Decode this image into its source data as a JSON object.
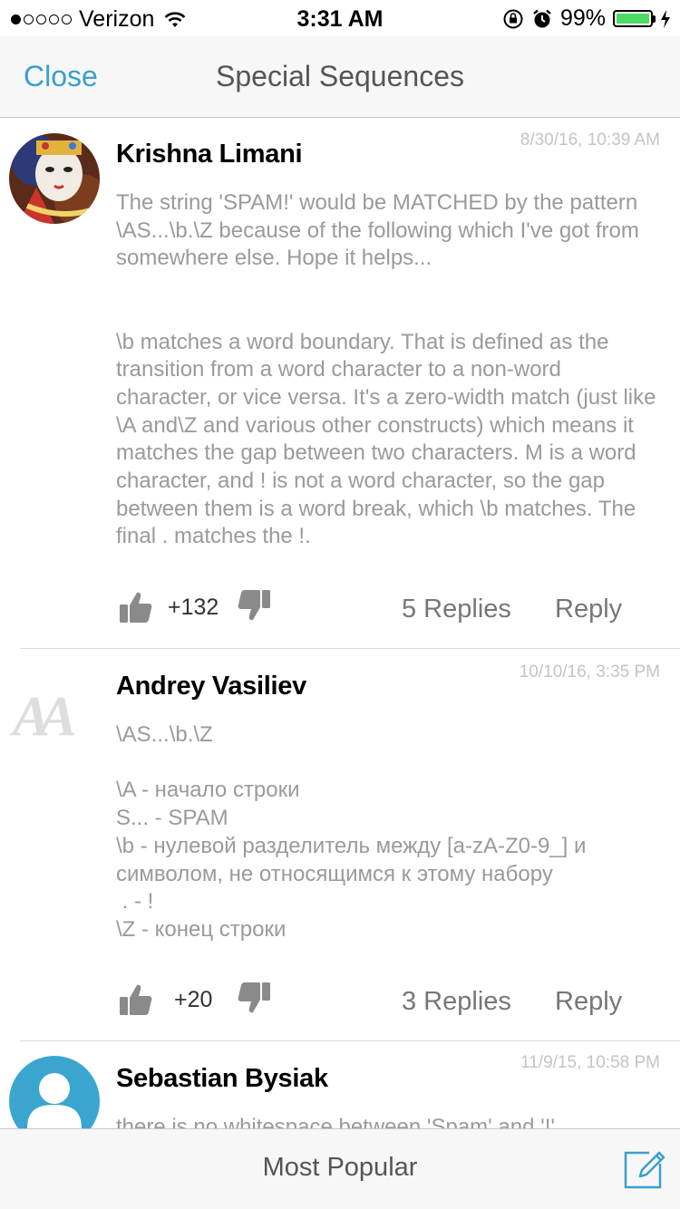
{
  "status_bar": {
    "carrier": "Verizon",
    "time": "3:31 AM",
    "battery": "99%",
    "battery_level": 0.99,
    "signal_bars_filled": 1,
    "signal_bars_total": 5
  },
  "nav": {
    "close_label": "Close",
    "title": "Special Sequences"
  },
  "comments": [
    {
      "author": "Krishna Limani",
      "date": "8/30/16, 10:39 AM",
      "body": "The string 'SPAM!' would be MATCHED by the pattern \\AS...\\b.\\Z because of the following which I've got from somewhere else. Hope it helps...\n\n\n\\b matches a word boundary. That is defined as the transition from a word character to a non-word character, or vice versa. It's a zero-width match (just like \\A and\\Z and various other constructs) which means it matches the gap between two characters. M is a word character, and ! is not a word character, so the gap between them is a word break, which \\b matches. The final . matches the !.",
      "votes": "+132",
      "replies": "5 Replies",
      "reply_label": "Reply"
    },
    {
      "author": "Andrey Vasiliev",
      "date": "10/10/16, 3:35 PM",
      "avatar_text": "AA",
      "body": "\\AS...\\b.\\Z\n\n\\A - начало строки\nS... - SPAM\n\\b - нулевой разделитель между [a-zA-Z0-9_] и символом, не относящимся к этому набору\n . - !\n\\Z - конец строки",
      "votes": "+20",
      "replies": "3 Replies",
      "reply_label": "Reply"
    },
    {
      "author": "Sebastian Bysiak",
      "date": "11/9/15, 10:58 PM",
      "body": "there is no whitespace between 'Spam' and '!'"
    }
  ],
  "tab_bar": {
    "label": "Most Popular"
  },
  "colors": {
    "accent": "#3a9fcd",
    "battery_green": "#4cd964",
    "avatar_blue": "#3aa6cf"
  }
}
